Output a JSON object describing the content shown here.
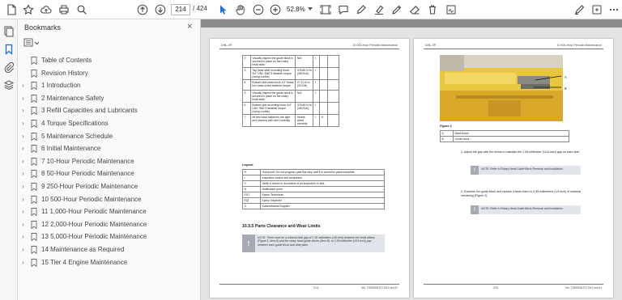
{
  "toolbar": {
    "page_current": "214",
    "page_total": "/ 424",
    "zoom": "52,8%"
  },
  "panel": {
    "title": "Bookmarks",
    "close": "×",
    "items": [
      {
        "label": "Table of Contents",
        "expandable": false
      },
      {
        "label": "Revision History",
        "expandable": false
      },
      {
        "label": "1 Introduction",
        "expandable": true
      },
      {
        "label": "2 Maintenance Safety",
        "expandable": true
      },
      {
        "label": "3 Refill Capacities and Lubricants",
        "expandable": true
      },
      {
        "label": "4 Torque Specifications",
        "expandable": true
      },
      {
        "label": "5 Maintenance Schedule",
        "expandable": true
      },
      {
        "label": "6 Initial Maintenance",
        "expandable": true
      },
      {
        "label": "7 10-Hour Periodic Maintenance",
        "expandable": true
      },
      {
        "label": "8 50-Hour Periodic Maintenance",
        "expandable": true
      },
      {
        "label": "9 250-Hour Periodic Maintenance",
        "expandable": true
      },
      {
        "label": "10 500-Hour Periodic Maintenance",
        "expandable": true
      },
      {
        "label": "11 1,000-Hour Periodic Maintenance",
        "expandable": true
      },
      {
        "label": "12 2,000-Hour Periodic Maintenance",
        "expandable": true
      },
      {
        "label": "13 5,000-Hour Periodic Maintenance",
        "expandable": true
      },
      {
        "label": "14 Maintenance as Required",
        "expandable": true
      },
      {
        "label": "15 Tier 4 Engine Maintenance",
        "expandable": true
      }
    ]
  },
  "left_page": {
    "header_left": "DrilL-XP",
    "header_right": "10 500-Hour Periodic Maintenance",
    "steps": [
      {
        "n": "2",
        "text": "Visually inspect the guide block is secured in place on the rotary head slide.",
        "val": "N/A",
        "chk": "I"
      },
      {
        "n": "3",
        "text": "Tap head slide mounting block 3/4\" UNC SAE 5 fastener torque (using Loctite)",
        "val": "378.65 N·m (280 ft-lb)",
        "chk": "I"
      },
      {
        "n": "4",
        "text": "Bottom side wear block 1/2\" brass hex head screw fastener torque",
        "val": "27.11 N·m (20 ft-lb)",
        "chk": "I"
      },
      {
        "n": "5",
        "text": "Visually inspect the guide block is secured in place on the rotary head slide.",
        "val": "N/A",
        "chk": "I"
      },
      {
        "n": "6",
        "text": "Bottom side mounting block 3/4\" UNC SAE 5 fastener torque (using Loctite)",
        "val": "378.65 N·m (280 ft-lb)",
        "chk": "I"
      },
      {
        "n": "7",
        "text": "All hex head fasteners are tight and secured with wire correctly.",
        "val": "Heads wired correctly",
        "chk": "I",
        "extra": "H"
      }
    ],
    "legend_title": "Legend",
    "legend": [
      {
        "k": "H",
        "v": "Hold point: Do not progress past this step until it is correct/in place/complete."
      },
      {
        "k": "I",
        "v": "Inspection and/or test completed."
      },
      {
        "k": "V",
        "v": "Verify a record or document of an inspection or test."
      },
      {
        "k": "N",
        "v": "Notification point"
      },
      {
        "k": "EGT",
        "v": "Epiroc Technician"
      },
      {
        "k": "EQI",
        "v": "Epiroc Inspector"
      },
      {
        "k": "S",
        "v": "Subcontractor/Supplier"
      }
    ],
    "section_title": "10.5.5 Parts Clearance and Wear Limits",
    "note": "NOTE: There must be a minimal total gap of 2.18 millimeters (1/8 inch) between the head sliders (Figure 1, item A) and the rotary head guide blocks (item B), or 1.59 millimeter (1/16 inch) gap between each guide block and slide plate.",
    "footer_left": "214",
    "footer_right": "No. T05000A727.001 rev.01"
  },
  "right_page": {
    "header_left": "DrilL-XP",
    "header_right": "10 500-Hour Periodic Maintenance",
    "callout_a": "A",
    "callout_b": "B",
    "figure_caption": "Figure 1",
    "fig_legend": [
      {
        "k": "A",
        "v": "Mast shoes"
      },
      {
        "k": "B",
        "v": "Guide block"
      }
    ],
    "step1": "1.   Adjust the gap with the shims to maintain the 1.59-millimeter (1/16-inch) gap on each side.",
    "note1": "NOTE: Refer to Rotary Head Guide Block Removal and Installation.",
    "step2": "2.   Examine the guide block and replace it when there is 6.35 millimeters (1/4 inch) of material remaining (Figure 2).",
    "note2": "NOTE: Refer to Rotary Head Guide Block Removal and Installation.",
    "footer_left": "215",
    "footer_right": "No. T05000A727.001 rev.01"
  },
  "icons": {
    "toolbar": [
      "new-document-icon",
      "bookmark-star-icon",
      "cloud-upload-icon",
      "print-icon",
      "search-icon",
      "page-up-icon",
      "page-down-icon",
      "pointer-icon",
      "hand-icon",
      "zoom-out-icon",
      "zoom-in-icon",
      "fit-page-icon",
      "comment-icon",
      "pen-icon",
      "highlight-icon",
      "draw-icon",
      "erase-icon",
      "stamp-icon",
      "signature-icon",
      "share-icon",
      "more-icon"
    ]
  }
}
